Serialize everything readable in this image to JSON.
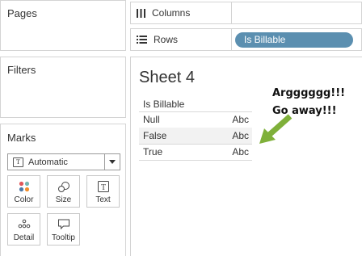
{
  "sidebar": {
    "pages": {
      "title": "Pages"
    },
    "filters": {
      "title": "Filters"
    },
    "marks": {
      "title": "Marks",
      "mark_type": "Automatic",
      "buttons": [
        {
          "label": "Color",
          "icon": "color-dots-icon"
        },
        {
          "label": "Size",
          "icon": "size-shapes-icon"
        },
        {
          "label": "Text",
          "icon": "text-icon"
        },
        {
          "label": "Detail",
          "icon": "detail-dots-icon"
        },
        {
          "label": "Tooltip",
          "icon": "speech-bubble-icon"
        }
      ]
    }
  },
  "shelves": {
    "columns": {
      "label": "Columns",
      "icon": "columns-icon"
    },
    "rows": {
      "label": "Rows",
      "icon": "rows-icon",
      "pill": "Is Billable",
      "pill_color": "#5b8fb0"
    }
  },
  "sheet": {
    "title": "Sheet 4",
    "header": "Is Billable",
    "rows": [
      {
        "key": "Null",
        "value": "Abc"
      },
      {
        "key": "False",
        "value": "Abc"
      },
      {
        "key": "True",
        "value": "Abc"
      }
    ],
    "highlight_row_color": "#f2f2f2"
  },
  "annotation": {
    "line1": "Argggggg!!!",
    "line2": "Go away!!!",
    "arrow_color": "#7fb03a"
  }
}
